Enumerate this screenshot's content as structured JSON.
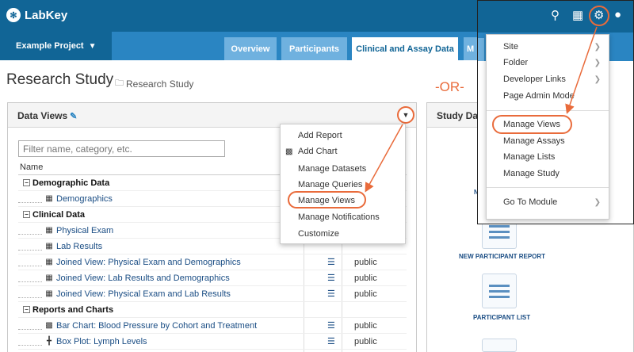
{
  "header": {
    "logo": "LabKey",
    "project_menu": "Example Project",
    "tabs": [
      "Overview",
      "Participants",
      "Clinical and Assay Data",
      "M"
    ]
  },
  "page": {
    "title": "Research Study",
    "breadcrumb": "Research Study",
    "or_label": "-OR-"
  },
  "data_views": {
    "title": "Data Views",
    "filter_placeholder": "Filter name, category, etc.",
    "column_name": "Name",
    "rows": [
      {
        "type": "category",
        "name": "Demographic Data"
      },
      {
        "type": "item",
        "name": "Demographics",
        "icon": "grid-icon",
        "details": "",
        "access": ""
      },
      {
        "type": "category",
        "name": "Clinical Data"
      },
      {
        "type": "item",
        "name": "Physical Exam",
        "icon": "grid-icon",
        "details": "",
        "access": ""
      },
      {
        "type": "item",
        "name": "Lab Results",
        "icon": "grid-icon",
        "details": "",
        "access": ""
      },
      {
        "type": "item",
        "name": "Joined View: Physical Exam and Demographics",
        "icon": "grid-icon",
        "details": "☰",
        "access": "public"
      },
      {
        "type": "item",
        "name": "Joined View: Lab Results and Demographics",
        "icon": "grid-icon",
        "details": "☰",
        "access": "public"
      },
      {
        "type": "item",
        "name": "Joined View: Physical Exam and Lab Results",
        "icon": "grid-icon",
        "details": "☰",
        "access": "public"
      },
      {
        "type": "category",
        "name": "Reports and Charts"
      },
      {
        "type": "item",
        "name": "Bar Chart: Blood Pressure by Cohort and Treatment",
        "icon": "bar-chart-icon",
        "details": "☰",
        "access": "public"
      },
      {
        "type": "item",
        "name": "Box Plot: Lymph Levels",
        "icon": "box-plot-icon",
        "details": "☰",
        "access": "public"
      }
    ],
    "menu": [
      "Add Report",
      "Add Chart",
      "Manage Datasets",
      "Manage Queries",
      "Manage Views",
      "Manage Notifications",
      "Customize"
    ]
  },
  "study_panel": {
    "title": "Study Da",
    "cut_label_1": "N",
    "cut_label_2": "T",
    "tiles": [
      "NEW PARTICIPANT REPORT",
      "PARTICIPANT LIST"
    ]
  },
  "admin_menu": {
    "items": [
      {
        "label": "Site",
        "chevron": true
      },
      {
        "label": "Folder",
        "chevron": true
      },
      {
        "label": "Developer Links",
        "chevron": true
      },
      {
        "label": "Page Admin Mode",
        "chevron": false
      },
      {
        "label": "Manage Views",
        "chevron": false
      },
      {
        "label": "Manage Assays",
        "chevron": false
      },
      {
        "label": "Manage Lists",
        "chevron": false
      },
      {
        "label": "Manage Study",
        "chevron": false
      },
      {
        "label": "Go To Module",
        "chevron": true
      }
    ]
  },
  "colors": {
    "header": "#116596",
    "navbar": "#2a85c2",
    "tab": "#6fb1df",
    "highlight": "#e96b3b",
    "link": "#1a4d84"
  }
}
